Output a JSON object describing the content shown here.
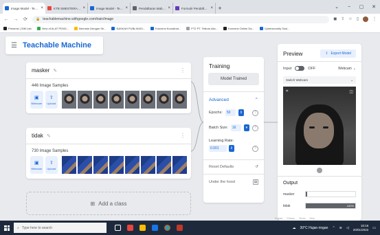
{
  "browser": {
    "tabs": [
      {
        "title": "Image Model - Teachable M...",
        "color": "#1967d2",
        "active": true
      },
      {
        "title": "KTB SMESTERAHI | Telkom",
        "color": "#e8453c",
        "active": false
      },
      {
        "title": "Image Model - Teachable M...",
        "color": "#1967d2",
        "active": false
      },
      {
        "title": "Pendaftaran Maba - STIE M...",
        "color": "#5f6368",
        "active": false
      },
      {
        "title": "Formulir Pendaftaran Mahas...",
        "color": "#673ab7",
        "active": false
      }
    ],
    "new_tab_label": "+",
    "window_controls": [
      "⌄",
      "−",
      "▢",
      "✕"
    ],
    "url": "teachablemachine.withgoogle.com/train/image",
    "bookmarks": [
      {
        "label": "Presensi | SIM Lab",
        "color": "#202124"
      },
      {
        "label": "View of ALAT PENG...",
        "color": "#34a853"
      },
      {
        "label": "Bermain Dengan Se...",
        "color": "#fbbc04"
      },
      {
        "label": "NASKAH PUBLIKASI...",
        "color": "#1967d2"
      },
      {
        "label": "Konversi Koordinat...",
        "color": "#1967d2"
      },
      {
        "label": "PT2 PT. Telkom Aks...",
        "color": "#9aa0a6"
      },
      {
        "label": "Konversi Online Da...",
        "color": "#202124"
      },
      {
        "label": "Cybersecurity Sosi...",
        "color": "#1967d2"
      }
    ]
  },
  "app": {
    "title": "Teachable Machine",
    "brand_color": "#1967d2"
  },
  "classes": [
    {
      "name": "masker",
      "samples_label": "446 Image Samples",
      "thumb_style": "face"
    },
    {
      "name": "tidak",
      "samples_label": "730 Image Samples",
      "thumb_style": "hand"
    }
  ],
  "sample_buttons": {
    "webcam": "Webcam",
    "upload": "Upload"
  },
  "add_class_label": "Add a class",
  "training": {
    "title": "Training",
    "train_button": "Model Trained",
    "advanced_label": "Advanced",
    "epochs_label": "Epochs:",
    "epochs_value": "50",
    "batch_label": "Batch Size:",
    "batch_value": "16",
    "lr_label": "Learning Rate:",
    "lr_value": "0.001",
    "reset_label": "Reset Defaults",
    "under_hood_label": "Under the hood"
  },
  "preview": {
    "title": "Preview",
    "export_label": "Export Model",
    "input_label": "Input",
    "toggle_state": "OFF",
    "webcam_label": "Webcam",
    "switch_label": "Switch Webcam",
    "output_title": "Output",
    "outputs": [
      {
        "label": "masker",
        "value": 0,
        "display": ""
      },
      {
        "label": "tidak",
        "value": 100,
        "display": "100%"
      }
    ]
  },
  "footer_strip": [
    "English",
    "Privacy",
    "Terms",
    "Help"
  ],
  "taskbar": {
    "search_placeholder": "Type here to search",
    "weather": "30°C  Hujan ringan",
    "time": "10:16",
    "date": "20/01/2022"
  }
}
